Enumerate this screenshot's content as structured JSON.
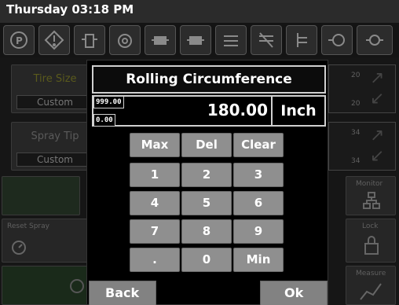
{
  "header": {
    "clock": "Thursday 03:18 PM"
  },
  "background": {
    "tire_size": {
      "label": "Tire Size",
      "value": "Custom"
    },
    "spray_tip": {
      "label": "Spray Tip",
      "value": "Custom"
    },
    "monitor_label": "Monitor",
    "reset_spray_label": "Reset Spray",
    "lock_label": "Lock",
    "measure_label": "Measure",
    "gauge_top": {
      "max": "20",
      "min": "20"
    },
    "gauge_bottom": {
      "max": "34",
      "min": "34"
    }
  },
  "icons": [
    "parking-icon",
    "warning-icon",
    "tank-icon",
    "pump-icon",
    "engine-icon",
    "engine-icon-2",
    "boom-section-icon",
    "boom-disable-icon",
    "boom-fold-icon",
    "sprayer-icon",
    "nozzle-icon"
  ],
  "dialog": {
    "title": "Rolling Circumference",
    "max_limit": "999.00",
    "min_limit": "0.00",
    "value": "180.00",
    "unit": "Inch",
    "keys": [
      [
        "Max",
        "Del",
        "Clear"
      ],
      [
        "1",
        "2",
        "3"
      ],
      [
        "4",
        "5",
        "6"
      ],
      [
        "7",
        "8",
        "9"
      ],
      [
        ".",
        "0",
        "Min"
      ]
    ],
    "back_label": "Back",
    "ok_label": "Ok"
  }
}
